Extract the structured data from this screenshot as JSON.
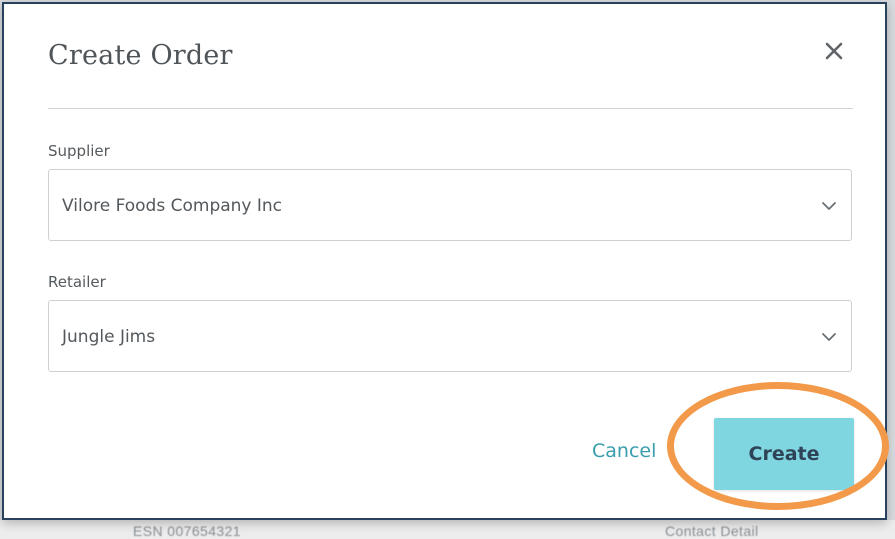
{
  "dialog": {
    "title": "Create Order",
    "close_icon": "close-icon"
  },
  "form": {
    "supplier": {
      "label": "Supplier",
      "selected_value": "Vilore Foods Company Inc",
      "icon": "chevron-down-icon"
    },
    "retailer": {
      "label": "Retailer",
      "selected_value": "Jungle Jims",
      "icon": "chevron-down-icon"
    }
  },
  "actions": {
    "cancel_label": "Cancel",
    "create_label": "Create"
  },
  "background": {
    "footer_left": "ESN 007654321",
    "footer_right": "Contact Detail"
  },
  "colors": {
    "primary_button": "#7fd5e0",
    "link": "#3a9dad",
    "highlight_ring": "#f29a4a",
    "modal_border": "#28415c"
  }
}
